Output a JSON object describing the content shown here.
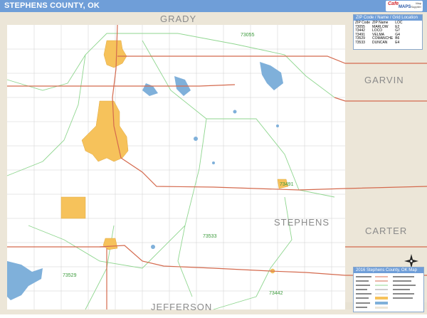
{
  "title": "STEPHENS COUNTY, OK",
  "brand": {
    "line1": "Cafe",
    "line2": "MAPS",
    "line3": "Map Supplier"
  },
  "counties": {
    "north": "GRADY",
    "east_upper": "GARVIN",
    "center": "STEPHENS",
    "east_lower": "CARTER",
    "south": "JEFFERSON"
  },
  "zip_labels": {
    "duncan_north": "73055",
    "marlow": "73055",
    "central": "73533",
    "velma": "73491",
    "comanche": "73529",
    "loco": "73442"
  },
  "zip_legend": {
    "heading": "ZIP Code / Name / Grid Location",
    "columns": [
      "ZIP Code",
      "ZIP Name",
      "LOC"
    ],
    "rows": [
      [
        "73055",
        "MARLOW",
        "E2"
      ],
      [
        "73442",
        "LOCO",
        "G7"
      ],
      [
        "73491",
        "VELMA",
        "G4"
      ],
      [
        "73529",
        "COMANCHE",
        "B6"
      ],
      [
        "73533",
        "DUNCAN",
        "E4"
      ]
    ]
  },
  "map_key": {
    "heading": "2016 Stephens County, OK Map"
  },
  "colors": {
    "title_bar": "#6f9ed8",
    "city_fill": "#f6c25b",
    "water": "#7fb0da",
    "neighbor": "#ece6d8",
    "road_major": "#d46a4e",
    "zip_line": "#8fd68f",
    "grid": "#c9c9c9"
  },
  "icons": [
    "compass-rose-icon"
  ]
}
